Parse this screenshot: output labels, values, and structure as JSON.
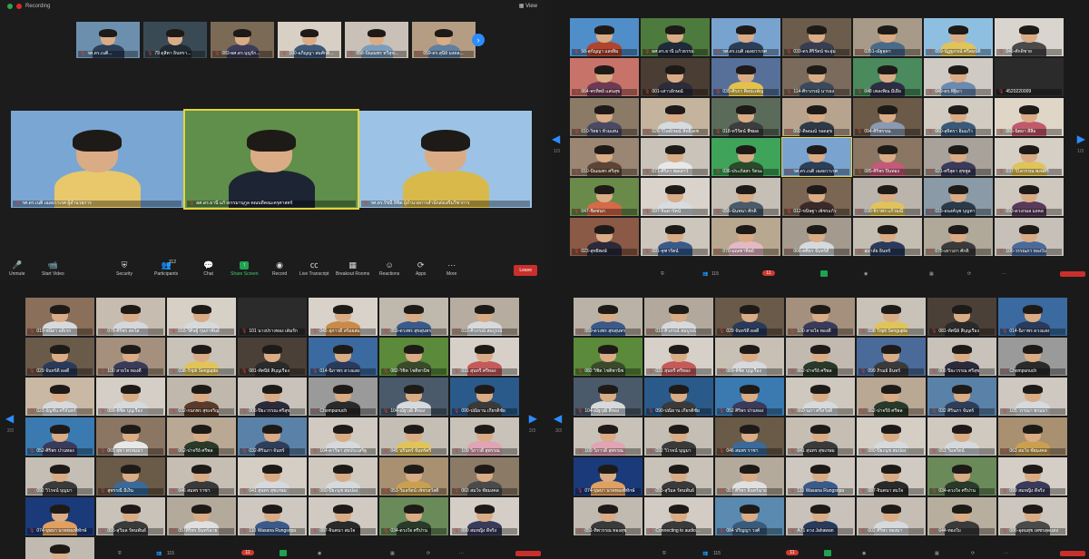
{
  "top_left": {
    "recording_label": "Recording",
    "view_label": "View",
    "strip": [
      {
        "name": "รศ.ดร.เนติ...",
        "bg": "#6d8fae",
        "body": "#2c3e58"
      },
      {
        "name": "79 ดุสิตา อินทรา...",
        "bg": "#3a4a55",
        "body": "#1f2a33"
      },
      {
        "name": "083-ผศ.ดร.บุญรัก...",
        "bg": "#7b6a55",
        "body": "#3c3c5a"
      },
      {
        "name": "100-อภิญญา สมศักดิ์...",
        "bg": "#d8d0c4",
        "body": "#3d5a7a"
      },
      {
        "name": "058-ปัณณพร ทวีสุข...",
        "bg": "#c9c1b8",
        "body": "#7a9dbb"
      },
      {
        "name": "059-ดร.สุนีย์ มงคล...",
        "bg": "#b59d84",
        "body": "#5f7fa0"
      }
    ],
    "speakers": [
      {
        "name": "รศ.ดร.เนติ เฉลยวาเรศ ผู้อำนวยการ",
        "bg": "#7aa6d4",
        "body": "#e8c86a",
        "active": false
      },
      {
        "name": "ผศ.ดร.ธานี แก้วธรรมานุกูล คณบดีคณะครุศาสตร์",
        "bg": "#5f8f4a",
        "body": "#1d2433",
        "active": true
      },
      {
        "name": "รศ.ดร.รัชนี ลิขิต ผู้อำนวยการสำนักส่งเสริมวิชาการ",
        "bg": "#9cc3e6",
        "body": "#d8b94a",
        "active": false
      }
    ],
    "toolbar": {
      "unmute": "Unmute",
      "start_video": "Start Video",
      "security": "Security",
      "participants": "Participants",
      "participants_count": "112",
      "chat": "Chat",
      "share_screen": "Share Screen",
      "record": "Record",
      "live_transcript": "Live Transcript",
      "breakout_rooms": "Breakout Rooms",
      "reactions": "Reactions",
      "apps": "Apps",
      "more": "More",
      "leave": "Leave"
    }
  },
  "top_right": {
    "page_label": "1/3",
    "tiles": [
      {
        "name": "58-สุกัญญา แสงยิ้ม",
        "bg": "#4f8ec9",
        "body": "#b0452f"
      },
      {
        "name": "ผศ.ดร.ธานี แก้วธรรม",
        "bg": "#4d7a3d",
        "body": "#1f2a3a"
      },
      {
        "name": "รศ.ดร.เนติ เฉลยวาเรศ",
        "bg": "#79a3cf",
        "body": "#2b3e57"
      },
      {
        "name": "033-ดร.ศิริรัตน์ ชะอุ่ม",
        "bg": "#6b5c4c",
        "body": "#383d52"
      },
      {
        "name": "0351-ณัฐสุดา",
        "bg": "#a89a88",
        "body": "#4a6a8a"
      },
      {
        "name": "059-นัฏฐภรณ์ ศรีสมบัติ",
        "bg": "#8fbfe0",
        "body": "#e0c45a"
      },
      {
        "name": "046-ศักดิ์ชาย",
        "bg": "#d9d5ce",
        "body": "#4a4a4a"
      },
      {
        "name": "064-พรทิพย์ แสนสุข",
        "bg": "#c8736a",
        "body": "#6e3a52"
      },
      {
        "name": "001-เสาวลักษณ์",
        "bg": "#4a3d34",
        "body": "#2c2c3a"
      },
      {
        "name": "035-ศิรภา ศิลปะเพ็ญ",
        "bg": "#56709a",
        "body": "#e2c24a"
      },
      {
        "name": "114-ศิราภรณ์ นารอง",
        "bg": "#7a6b5d",
        "body": "#3a4a5a"
      },
      {
        "name": "048 เพลงพิณ มีเผือ",
        "bg": "#4a8a5c",
        "body": "#2d2d44"
      },
      {
        "name": "049-ดร.ทิฐิมา",
        "bg": "#cfcac4",
        "body": "#6a8ab0"
      },
      {
        "name": "4520220009",
        "bg": "#2b2b2b",
        "body": "#2b2b2b"
      },
      {
        "name": "010-วิทยา ท้วมเสน",
        "bg": "#8a7a66",
        "body": "#4a4a66"
      },
      {
        "name": "026-วิไลลักษณ์ สิทธิเดช",
        "bg": "#c4b49e",
        "body": "#d6dbe0"
      },
      {
        "name": "018-ทวีรัตน์ พืชผล",
        "bg": "#5a6b5a",
        "body": "#3d3d3d"
      },
      {
        "name": "092-ดิษณณ์ รอดสุข",
        "bg": "#b8a48e",
        "body": "#2e3a48"
      },
      {
        "name": "094-ศิริพรรณ",
        "bg": "#6c5a48",
        "body": "#8a9ab0"
      },
      {
        "name": "060-สุจิตรา อิ่มแก้ว",
        "bg": "#d2cbc2",
        "body": "#3a5a7a"
      },
      {
        "name": "065-นิตยา สีลือ",
        "bg": "#e0d6c8",
        "body": "#c05a6a"
      },
      {
        "name": "010-ปัณณพร ศรีสุข",
        "bg": "#9a8672",
        "body": "#5e4434"
      },
      {
        "name": "071-ศิริภา พลเยาว์",
        "bg": "#c9c3ba",
        "body": "#e8e8e8"
      },
      {
        "name": "036-ประภัสสร รัตนะ",
        "bg": "#3fa35a",
        "body": "#2a4a2a"
      },
      {
        "name": "รศ.ดร.เนติ เฉลยวาเรศ",
        "bg": "#7aa3cf",
        "body": "#2c3e58",
        "hl": true
      },
      {
        "name": "085-ศิริพร ปิ่นทอง",
        "bg": "#8a7662",
        "body": "#c45a7a"
      },
      {
        "name": "021-ศรีสุดา สุขพูล",
        "bg": "#a8a29a",
        "body": "#3a3a5a"
      },
      {
        "name": "037-วิไลวรรณ พงษ์ศิริ",
        "bg": "#d6cfc6",
        "body": "#e0c45a"
      },
      {
        "name": "047-ชิดชนก",
        "bg": "#6a8a4a",
        "body": "#d46a4a"
      },
      {
        "name": "097-จินดารัตน์",
        "bg": "#d9d3cb",
        "body": "#d8dcdf"
      },
      {
        "name": "056-นันทนา ศักดิ์",
        "bg": "#c5bfb5",
        "body": "#4a5a6a"
      },
      {
        "name": "012-ขนิษฐา เพ็ชรแก้ว",
        "bg": "#7a6652",
        "body": "#3a2a2a"
      },
      {
        "name": "030-จิราพร แก้วมณี",
        "bg": "#bab4ac",
        "body": "#e0c45a"
      },
      {
        "name": "015-อนงค์นุช บุญทา",
        "bg": "#8a9aa6",
        "body": "#2a3a4a"
      },
      {
        "name": "093-ดวงกมล มงคล",
        "bg": "#cfc8be",
        "body": "#5a3a5a"
      },
      {
        "name": "023-สุทธิพงษ์",
        "bg": "#8a5a46",
        "body": "#2a2a3a"
      },
      {
        "name": "091-จุฑารัตน์",
        "bg": "#cdc6bc",
        "body": "#3a5a8a"
      },
      {
        "name": "070-มณฑาทิพย์",
        "bg": "#b8a890",
        "body": "#e4b8c4"
      },
      {
        "name": "066-ศศิธร จันทร์ดี",
        "bg": "#a49a8e",
        "body": "#d6dadd"
      },
      {
        "name": "สุมาลัย อินทร์",
        "bg": "#c4bdb2",
        "body": "#2a3a5a"
      },
      {
        "name": "075-เยาวภา ศักดิ์",
        "bg": "#b0a898",
        "body": "#3a3a3a"
      },
      {
        "name": "106-วรรณภา ทองใบ",
        "bg": "#c6c0b8",
        "body": "#4a6a9a"
      }
    ],
    "participants_count": "115",
    "chat_badge": "11"
  },
  "bottom_left": {
    "page_label": "2/3",
    "tiles": [
      {
        "name": "019-ชนิดา อดิเรก",
        "bg": "#8a6f5a",
        "body": "#d6dadd"
      },
      {
        "name": "078-ศิริพร สดใส",
        "bg": "#c6bdb0",
        "body": "#d4d8dc"
      },
      {
        "name": "016-วิศิษฐ์ กุมภาพันธ์",
        "bg": "#d7d0c6",
        "body": "#d6dadd"
      },
      {
        "name": "101 นางปรางทอง เต็มรัก",
        "bg": "#2b2b2b",
        "body": "#2b2b2b"
      },
      {
        "name": "045 สุภาวดี สร้อยสม",
        "bg": "#d8d2ca",
        "body": "#c98a4a"
      },
      {
        "name": "059-ดวงพร สุขสุนทร",
        "bg": "#bfb8ad",
        "body": "#3a5a8a"
      },
      {
        "name": "010-ศิวภรณ์ สมบูรณ์",
        "bg": "#b6ac9f",
        "body": "#d6dadd"
      },
      {
        "name": "029 จันทร์ดี ผลดี",
        "bg": "#6a5a4a",
        "body": "#2a3a5a"
      },
      {
        "name": "100 สายใจ ทองดี",
        "bg": "#a4907c",
        "body": "#3a3a5a"
      },
      {
        "name": "038-Tripti Sengupta",
        "bg": "#c8c2b8",
        "body": "#e0c45a"
      },
      {
        "name": "081-ทัศนีย์ สีบุญเรือง",
        "bg": "#4a4038",
        "body": "#2a2a2a"
      },
      {
        "name": "014-นิภาพร ดวงแสง",
        "bg": "#3a6aa0",
        "body": "#2a3a5a"
      },
      {
        "name": "082-วิชิต โชติพานิช",
        "bg": "#5a8a3a",
        "body": "#3a4a2a"
      },
      {
        "name": "031 สุนทรี ศรีทอง",
        "bg": "#d6d0c8",
        "body": "#c45a5a"
      },
      {
        "name": "023 อัญชัน ศรีจันทร์",
        "bg": "#c8b8a4",
        "body": "#d6dadd"
      },
      {
        "name": "089-พิชิต บุญเรือง",
        "bg": "#d4cec6",
        "body": "#d6dadd"
      },
      {
        "name": "032-กนกพร สุขเจริญ",
        "bg": "#c0b8ac",
        "body": "#5a3a2a"
      },
      {
        "name": "006-ปิยะวรรณ ศรีสุข",
        "bg": "#c8c2ba",
        "body": "#2a2a3a"
      },
      {
        "name": "Chompunuch",
        "bg": "#9a9a9a",
        "body": "#2a2a2a"
      },
      {
        "name": "104-ณัฐวุฒิ สีทอง",
        "bg": "#4a5a6a",
        "body": "#d6dadd"
      },
      {
        "name": "090-ปณิธาน เกียรติชัย",
        "bg": "#2a5a8a",
        "body": "#3a3a3a"
      },
      {
        "name": "052-ศิริพร ปานทอง",
        "bg": "#3a7ab0",
        "body": "#3a3a5a"
      },
      {
        "name": "065 ยุพา พรหมมา",
        "bg": "#8a7662",
        "body": "#e8e8e8"
      },
      {
        "name": "062-ปาจรีย์ ศรีพล",
        "bg": "#b8a894",
        "body": "#2a3a2a"
      },
      {
        "name": "032-ศิรินภา จันทร์",
        "bg": "#5a82a8",
        "body": "#2e3e58"
      },
      {
        "name": "104-ดาวิษา สุขประเสริฐ",
        "bg": "#d0cac2",
        "body": "#d6dadd"
      },
      {
        "name": "045 นรินทร์ จันทร์ศรี",
        "bg": "#c4beb4",
        "body": "#e0c45a"
      },
      {
        "name": "109 วิภาวดี สุพรรณ",
        "bg": "#c8c2b8",
        "body": "#e0a4b4"
      },
      {
        "name": "092 วิโรจน์ บุญมา",
        "bg": "#c4beb5",
        "body": "#3a3a3a"
      },
      {
        "name": "สุพรรณี มีเงิน",
        "bg": "#6a5a48",
        "body": "#3a6a9a"
      },
      {
        "name": "046 สมพร ราชา",
        "bg": "#c6beb2",
        "body": "#3a3a3a"
      },
      {
        "name": "041 สุนทร สุขเกษม",
        "bg": "#d4cec5",
        "body": "#d6dadd"
      },
      {
        "name": "080-ปิยะนุช สมปอง",
        "bg": "#cfc9c0",
        "body": "#d6dadd"
      },
      {
        "name": "053-วิมลรัตน์ เพ็ชรสวัสดิ์",
        "bg": "#a89070",
        "body": "#c8a050"
      },
      {
        "name": "063 สมใจ ชัยมงคล",
        "bg": "#8a7a66",
        "body": "#4a4a4a"
      },
      {
        "name": "074-บุษบา นาคทองพิทักษ์",
        "bg": "#1a3a7a",
        "body": "#e0a060"
      },
      {
        "name": "055-สุวิมล รัตนพันธ์",
        "bg": "#c8c2b8",
        "body": "#3a3a3a"
      },
      {
        "name": "057ศิริพร อินทร์ฉาย",
        "bg": "#b4aa9c",
        "body": "#e0e0e0"
      },
      {
        "name": "110 Wasana Rungsripa",
        "bg": "#cec8c0",
        "body": "#3a5a8a"
      },
      {
        "name": "087-จินตนา สมใจ",
        "bg": "#d0cac2",
        "body": "#2a2a2a"
      },
      {
        "name": "034-ดวงใจ ศรีปาน",
        "bg": "#6a8a5a",
        "body": "#2a3a2a"
      },
      {
        "name": "099 สมหญิง ดีจริง",
        "bg": "#d4cec6",
        "body": "#3a3a5a"
      },
      {
        "name": "051-ทิพวรรณ ทองสุข",
        "bg": "#c0bab0",
        "body": "#3a3a3a"
      }
    ],
    "participants_count": "115",
    "chat_badge": "11"
  },
  "bottom_right": {
    "page_label": "3/3",
    "tiles": [
      {
        "name": "059-ดวงพร สุขสุนทร",
        "bg": "#bab2a6",
        "body": "#3a5a8a"
      },
      {
        "name": "010 ศิวภรณ์ สมบูรณ์",
        "bg": "#b2a89c",
        "body": "#d6dadd"
      },
      {
        "name": "029 จันทร์ดี ผลดี",
        "bg": "#6a5a4a",
        "body": "#2a3a5a"
      },
      {
        "name": "100 สายใจ ทองดี",
        "bg": "#a4907c",
        "body": "#3a3a5a"
      },
      {
        "name": "038 Tripti Sengupta",
        "bg": "#c8c2b8",
        "body": "#e0c45a"
      },
      {
        "name": "081-ทัศนีย์ สีบุญเรือง",
        "bg": "#4a4038",
        "body": "#2a2a2a"
      },
      {
        "name": "014-นิภาพร ดวงแสง",
        "bg": "#3a6aa0",
        "body": "#2a3a5a"
      },
      {
        "name": "082 วิชิต โชติพานิช",
        "bg": "#5a8a3a",
        "body": "#3a4a2a"
      },
      {
        "name": "031 สุนทรี ศรีทอง",
        "bg": "#d6d0c8",
        "body": "#c45a5a"
      },
      {
        "name": "089-พิชิต บุญเรือง",
        "bg": "#c8c0b4",
        "body": "#d6dadd"
      },
      {
        "name": "062-ปาจรีย์ ศรีพล",
        "bg": "#c2bab0",
        "body": "#2a3a2a"
      },
      {
        "name": "099 ภิรมย์ อินทร์",
        "bg": "#4a6a9a",
        "body": "#3a3a3a"
      },
      {
        "name": "006 ปิยะวรรณ ศรีสุข",
        "bg": "#c8c2ba",
        "body": "#2a2a3a"
      },
      {
        "name": "Chompunuch",
        "bg": "#9a9a9a",
        "body": "#2a2a2a"
      },
      {
        "name": "104-ณัฐวุฒิ สีทอง",
        "bg": "#4a5a6a",
        "body": "#d6dadd"
      },
      {
        "name": "090-ปณิธาน เกียรติชัย",
        "bg": "#2a5a8a",
        "body": "#3a3a3a"
      },
      {
        "name": "052 ศิริพร ปานทอง",
        "bg": "#3a7ab0",
        "body": "#3a3a5a"
      },
      {
        "name": "060-นภา ศรีสวัสดิ์",
        "bg": "#cec8be",
        "body": "#d6dadd"
      },
      {
        "name": "062-ปาจรีย์ ศรีพล",
        "bg": "#b8a894",
        "body": "#2a3a2a"
      },
      {
        "name": "032 ศิรินภา จันทร์",
        "bg": "#5a82a8",
        "body": "#2e3e58"
      },
      {
        "name": "105 วรรณา พรมมา",
        "bg": "#cec8c0",
        "body": "#d6dadd"
      },
      {
        "name": "109 วิภาวดี สุพรรณ",
        "bg": "#c8c2b8",
        "body": "#e0a4b4"
      },
      {
        "name": "092 วิโรจน์ บุญมา",
        "bg": "#c4beb5",
        "body": "#3a3a3a"
      },
      {
        "name": "046 สมพร ราชา",
        "bg": "#6a5a48",
        "body": "#3a6a9a"
      },
      {
        "name": "041 สุนทร สุขเกษม",
        "bg": "#c6beb2",
        "body": "#3a3a3a"
      },
      {
        "name": "080-ปิยะนุช สมปอง",
        "bg": "#d4cec5",
        "body": "#d6dadd"
      },
      {
        "name": "053 วิมลรัตน์",
        "bg": "#cfc9c0",
        "body": "#d6dadd"
      },
      {
        "name": "063 สมใจ ชัยมงคล",
        "bg": "#a89070",
        "body": "#c8a050"
      },
      {
        "name": "074-บุษบา นาคทองพิทักษ์",
        "bg": "#1a3a7a",
        "body": "#e0a060"
      },
      {
        "name": "055-สุวิมล รัตนพันธ์",
        "bg": "#c8c2b8",
        "body": "#3a3a3a"
      },
      {
        "name": "057 ศิริพร อินทร์ฉาย",
        "bg": "#b4aa9c",
        "body": "#e0e0e0"
      },
      {
        "name": "110 Wasana Rungsripa",
        "bg": "#cec8c0",
        "body": "#3a5a8a"
      },
      {
        "name": "087-จินตนา สมใจ",
        "bg": "#d0cac2",
        "body": "#2a2a2a"
      },
      {
        "name": "034-ดวงใจ ศรีปาน",
        "bg": "#6a8a5a",
        "body": "#2a3a2a"
      },
      {
        "name": "099 สมหญิง ดีจริง",
        "bg": "#d4cec6",
        "body": "#3a3a5a"
      },
      {
        "name": "051-ทิพวรรณ ทองสุข",
        "bg": "#c0bab0",
        "body": "#3a3a3a"
      },
      {
        "name": "Connecting to audio...",
        "bg": "#d2ccc4",
        "body": "#3a3a3a"
      },
      {
        "name": "084 ปริญญา วงศ์",
        "bg": "#5a8ab0",
        "body": "#3a5a7a"
      },
      {
        "name": "A71 ดวง Jahawan",
        "bg": "#c8c2ba",
        "body": "#2a3a5a"
      },
      {
        "name": "002 ศิริพร ทองมา",
        "bg": "#c6beb4",
        "body": "#d6dadd"
      },
      {
        "name": "044-ทองใบ",
        "bg": "#b8ae9e",
        "body": "#3a3a3a"
      },
      {
        "name": "086-อุดมสุข เพชรสุดแดง",
        "bg": "#ccc6be",
        "body": "#4a4a4a"
      }
    ],
    "participants_count": "115",
    "chat_badge": "11"
  }
}
